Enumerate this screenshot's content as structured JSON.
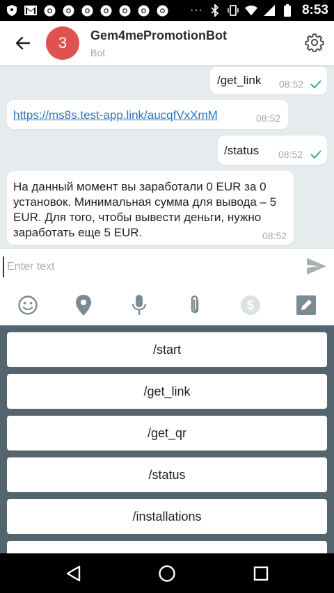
{
  "status_bar": {
    "time": "8:53",
    "left_icons": [
      "shield-icon",
      "gmail-icon",
      "chrome-icon",
      "chrome-icon",
      "chrome-icon",
      "chrome-icon",
      "chrome-icon",
      "chrome-icon",
      "chrome-icon"
    ],
    "overflow": "···",
    "right_icons": [
      "bluetooth-icon",
      "vibrate-icon",
      "wifi-icon",
      "cell-signal-icon",
      "battery-icon"
    ]
  },
  "header": {
    "avatar_text": "3",
    "avatar_color": "#e0524f",
    "title": "Gem4mePromotionBot",
    "subtitle": "Bot"
  },
  "messages": [
    {
      "direction": "out",
      "text": "/get_link",
      "time": "08:52",
      "read": true
    },
    {
      "direction": "in",
      "text": "https://ms8s.test-app.link/aucqfVxXmM",
      "time": "08:52",
      "is_link": true
    },
    {
      "direction": "out",
      "text": "/status",
      "time": "08:52",
      "read": true
    },
    {
      "direction": "in",
      "text": "На данный момент вы заработали 0 EUR за 0 установок. Минимальная сумма для вывода – 5 EUR. Для того, чтобы вывести деньги, нужно заработать еще 5 EUR.",
      "time": "08:52"
    }
  ],
  "input": {
    "placeholder": "Enter text"
  },
  "attach_icons": [
    "emoji-icon",
    "location-icon",
    "microphone-icon",
    "paperclip-icon",
    "dollar-icon",
    "pencil-icon"
  ],
  "keyboard": {
    "buttons": [
      "/start",
      "/get_link",
      "/get_qr",
      "/status",
      "/installations"
    ]
  },
  "colors": {
    "accent": "#2c73b8",
    "check": "#3aa6a0",
    "keyboard_bg": "#546570",
    "chat_bg": "#e6ebee"
  }
}
